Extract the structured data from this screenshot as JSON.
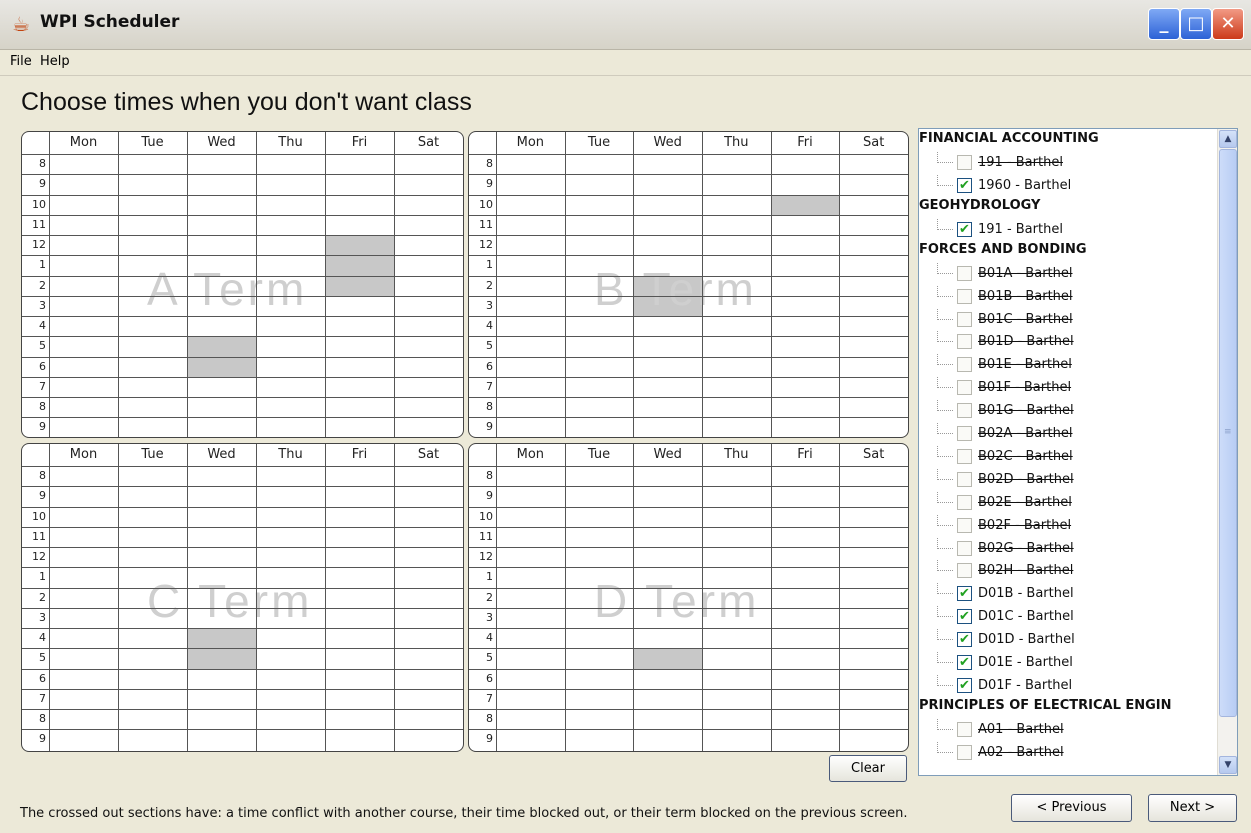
{
  "window": {
    "title": "WPI Scheduler",
    "app_icon": "java-coffee-cup-icon",
    "min_glyph": "_",
    "max_glyph": "□",
    "close_glyph": "✕"
  },
  "menu": {
    "file": "File",
    "help": "Help"
  },
  "heading": "Choose times when you don't want class",
  "days": [
    "Mon",
    "Tue",
    "Wed",
    "Thu",
    "Fri",
    "Sat"
  ],
  "hours": [
    "8",
    "9",
    "10",
    "11",
    "12",
    "1",
    "2",
    "3",
    "4",
    "5",
    "6",
    "7",
    "8",
    "9"
  ],
  "terms": [
    {
      "label": "A Term",
      "blocked": [
        {
          "day": "Fri",
          "from": 12,
          "to": 2
        },
        {
          "day": "Wed",
          "from": 5,
          "to": 6
        }
      ]
    },
    {
      "label": "B Term",
      "blocked": [
        {
          "day": "Fri",
          "from": 10,
          "to": 10
        },
        {
          "day": "Wed",
          "from": 2,
          "to": 3
        }
      ]
    },
    {
      "label": "C Term",
      "blocked": [
        {
          "day": "Wed",
          "from": 4,
          "to": 5
        }
      ]
    },
    {
      "label": "D Term",
      "blocked": [
        {
          "day": "Wed",
          "from": 5,
          "to": 5
        }
      ]
    }
  ],
  "tree": [
    {
      "course": "FINANCIAL ACCOUNTING",
      "sections": [
        {
          "label": "191 - Barthel",
          "checked": false,
          "struck": true
        },
        {
          "label": "1960 - Barthel",
          "checked": true,
          "struck": false
        }
      ]
    },
    {
      "course": "GEOHYDROLOGY",
      "sections": [
        {
          "label": "191 - Barthel",
          "checked": true,
          "struck": false
        }
      ]
    },
    {
      "course": "FORCES AND BONDING",
      "sections": [
        {
          "label": "B01A - Barthel",
          "checked": false,
          "struck": true
        },
        {
          "label": "B01B - Barthel",
          "checked": false,
          "struck": true
        },
        {
          "label": "B01C - Barthel",
          "checked": false,
          "struck": true
        },
        {
          "label": "B01D - Barthel",
          "checked": false,
          "struck": true
        },
        {
          "label": "B01E - Barthel",
          "checked": false,
          "struck": true
        },
        {
          "label": "B01F - Barthel",
          "checked": false,
          "struck": true
        },
        {
          "label": "B01G - Barthel",
          "checked": false,
          "struck": true
        },
        {
          "label": "B02A - Barthel",
          "checked": false,
          "struck": true
        },
        {
          "label": "B02C - Barthel",
          "checked": false,
          "struck": true
        },
        {
          "label": "B02D - Barthel",
          "checked": false,
          "struck": true
        },
        {
          "label": "B02E - Barthel",
          "checked": false,
          "struck": true
        },
        {
          "label": "B02F - Barthel",
          "checked": false,
          "struck": true
        },
        {
          "label": "B02G - Barthel",
          "checked": false,
          "struck": true
        },
        {
          "label": "B02H - Barthel",
          "checked": false,
          "struck": true
        },
        {
          "label": "D01B - Barthel",
          "checked": true,
          "struck": false
        },
        {
          "label": "D01C - Barthel",
          "checked": true,
          "struck": false
        },
        {
          "label": "D01D - Barthel",
          "checked": true,
          "struck": false
        },
        {
          "label": "D01E - Barthel",
          "checked": true,
          "struck": false
        },
        {
          "label": "D01F - Barthel",
          "checked": true,
          "struck": false
        }
      ]
    },
    {
      "course": "PRINCIPLES OF ELECTRICAL ENGIN",
      "sections": [
        {
          "label": "A01 - Barthel",
          "checked": false,
          "struck": true
        },
        {
          "label": "A02 - Barthel",
          "checked": false,
          "struck": true
        }
      ]
    }
  ],
  "buttons": {
    "clear": "Clear",
    "previous": "< Previous",
    "next": "Next >"
  },
  "footer_note": "The crossed out sections have: a time conflict with another course, their time blocked out, or their term blocked on the previous screen.",
  "colors": {
    "blocked": "#c8c8c8",
    "check": "#21a121",
    "grid_line": "#555555"
  }
}
